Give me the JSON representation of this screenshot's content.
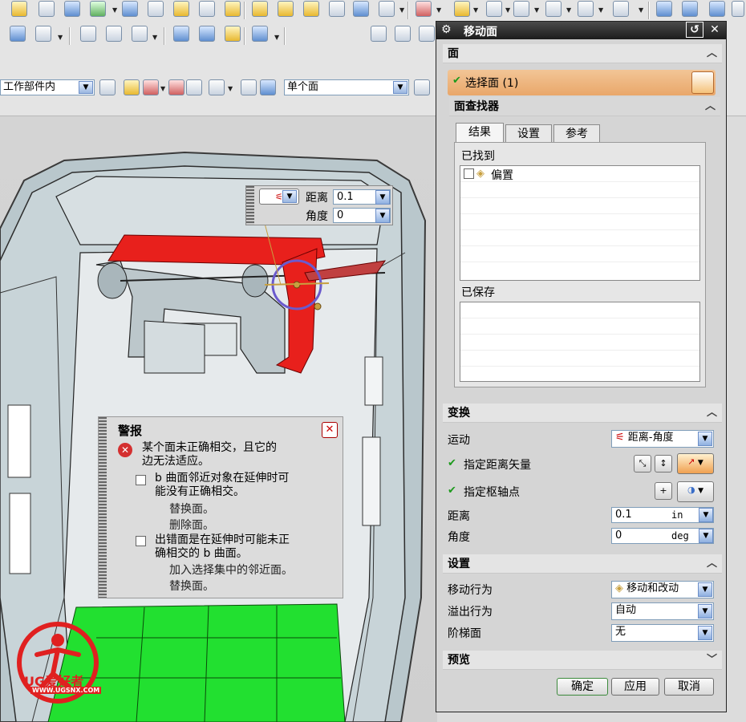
{
  "toolbar": {
    "scope_combo": "工作部件内",
    "face_rule_combo": "单个面"
  },
  "float_input": {
    "distance_label": "距离",
    "distance_value": "0.1",
    "angle_label": "角度",
    "angle_value": "0"
  },
  "alert": {
    "title": "警报",
    "error_text": "某个面未正确相交，且它的\n边无法适应。",
    "item1_text": "b 曲面邻近对象在延伸时可\n能没有正确相交。",
    "item1_actions": [
      "替换面。",
      "删除面。"
    ],
    "item2_text": "出错面是在延伸时可能未正\n确相交的 b 曲面。",
    "item2_actions": [
      "加入选择集中的邻近面。",
      "替换面。"
    ]
  },
  "dialog": {
    "title": "移动面",
    "face_group": {
      "header": "面",
      "select_label": "选择面 (1)",
      "finder_header": "面查找器",
      "tabs": [
        "结果",
        "设置",
        "参考"
      ],
      "found_label": "已找到",
      "found_items": [
        "偏置"
      ],
      "saved_label": "已保存"
    },
    "transform": {
      "header": "变换",
      "motion_label": "运动",
      "motion_value": "距离-角度",
      "vector_label": "指定距离矢量",
      "pivot_label": "指定枢轴点",
      "distance_label": "距离",
      "distance_value": "0.1",
      "distance_unit": "in",
      "angle_label": "角度",
      "angle_value": "0",
      "angle_unit": "deg"
    },
    "settings": {
      "header": "设置",
      "move_behavior_label": "移动行为",
      "move_behavior_value": "移动和改动",
      "overflow_label": "溢出行为",
      "overflow_value": "自动",
      "step_face_label": "阶梯面",
      "step_face_value": "无"
    },
    "preview_header": "预览",
    "buttons": {
      "ok": "确定",
      "apply": "应用",
      "cancel": "取消"
    }
  },
  "watermark": {
    "brand": "UG爱好者",
    "url": "WWW.UGSNX.COM"
  },
  "colors": {
    "accent_selected": "#e9a76a",
    "face_highlight": "#e8201c",
    "green_face": "#22e030",
    "pivot_ring": "#6a5acd"
  }
}
